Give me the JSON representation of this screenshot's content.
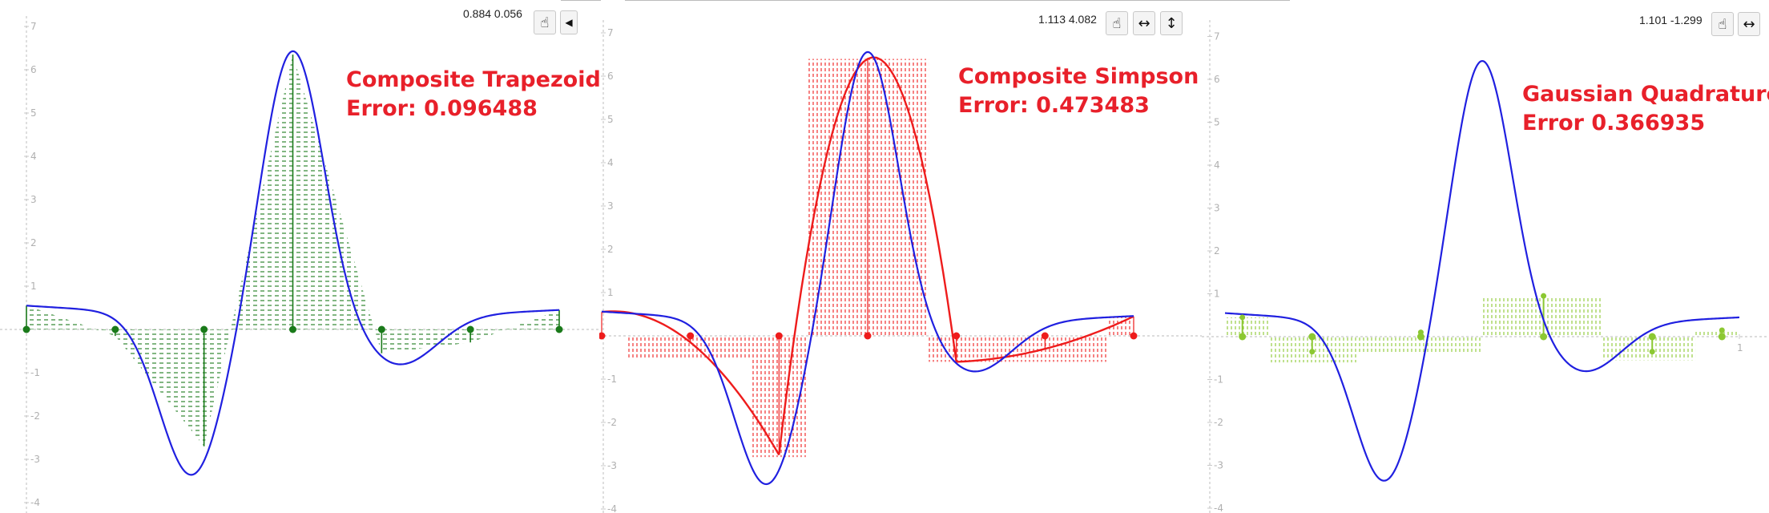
{
  "colors": {
    "curve": "#2020e0",
    "trapezoid": "#1a7a1a",
    "simpson": "#ee1c1c",
    "gauss": "#8cc832",
    "title": "#e8202a",
    "axis": "#c8c8c8",
    "tick_label": "#b0b0b0"
  },
  "chart_data": [
    {
      "type": "line",
      "title": "Composite Trapezoid",
      "error_text": "Error: 0.096488",
      "xlim": [
        0,
        1
      ],
      "ylim": [
        -4,
        7
      ],
      "y_ticks": [
        "-4",
        "-3",
        "-2",
        "-1",
        "1",
        "2",
        "3",
        "4",
        "5",
        "6",
        "7"
      ],
      "curve_peak": {
        "x": 0.5,
        "y": 6.35
      },
      "curve_trough": {
        "x": 0.31,
        "y": -3.2
      },
      "nodes": [
        {
          "x": 0.0,
          "y": 0.55
        },
        {
          "x": 0.1667,
          "y": -0.15
        },
        {
          "x": 0.3333,
          "y": -2.7
        },
        {
          "x": 0.5,
          "y": 6.35
        },
        {
          "x": 0.6667,
          "y": -0.55
        },
        {
          "x": 0.8333,
          "y": -0.3
        },
        {
          "x": 1.0,
          "y": 0.45
        }
      ],
      "readout": "0.884 0.056"
    },
    {
      "type": "line",
      "title": "Composite Simpson",
      "error_text": "Error: 0.473483",
      "xlim": [
        0,
        1
      ],
      "ylim": [
        -4,
        7
      ],
      "y_ticks": [
        "-4",
        "-3",
        "-2",
        "-1",
        "1",
        "2",
        "3",
        "4",
        "5",
        "6",
        "7"
      ],
      "nodes": [
        {
          "x": 0.0,
          "y": 0.55
        },
        {
          "x": 0.1667,
          "y": -0.15
        },
        {
          "x": 0.3333,
          "y": -2.75
        },
        {
          "x": 0.5,
          "y": 6.4
        },
        {
          "x": 0.6667,
          "y": -0.6
        },
        {
          "x": 0.8333,
          "y": -0.3
        },
        {
          "x": 1.0,
          "y": 0.45
        }
      ],
      "simpson_bars": [
        {
          "x0": 0.05,
          "x1": 0.28,
          "h": -0.55
        },
        {
          "x0": 0.28,
          "x1": 0.385,
          "h": -2.8
        },
        {
          "x0": 0.385,
          "x1": 0.615,
          "h": 6.4
        },
        {
          "x0": 0.615,
          "x1": 0.95,
          "h": -0.6
        },
        {
          "x0": 0.95,
          "x1": 1.0,
          "h": 0.45
        }
      ],
      "readout": "1.113 4.082"
    },
    {
      "type": "line",
      "title": "Gaussian Quadrature",
      "error_text": "Error 0.366935",
      "xlim": [
        0,
        1
      ],
      "ylim": [
        -4,
        7
      ],
      "y_ticks": [
        "-4",
        "-3",
        "-2",
        "-1",
        "1",
        "2",
        "3",
        "4",
        "5",
        "6",
        "7"
      ],
      "x_ticks": [
        "1"
      ],
      "nodes": [
        {
          "x": 0.0338,
          "y": 0.45
        },
        {
          "x": 0.1694,
          "y": -0.35
        },
        {
          "x": 0.3807,
          "y": 0.1
        },
        {
          "x": 0.6193,
          "y": 0.95
        },
        {
          "x": 0.8306,
          "y": -0.35
        },
        {
          "x": 0.9662,
          "y": 0.15
        }
      ],
      "gauss_bars": [
        {
          "x0": 0.0,
          "x1": 0.085,
          "h": 0.45
        },
        {
          "x0": 0.085,
          "x1": 0.26,
          "h": -0.6
        },
        {
          "x0": 0.26,
          "x1": 0.5,
          "h": -0.4
        },
        {
          "x0": 0.5,
          "x1": 0.735,
          "h": 0.95
        },
        {
          "x0": 0.735,
          "x1": 0.915,
          "h": -0.55
        },
        {
          "x0": 0.915,
          "x1": 1.0,
          "h": 0.15
        }
      ],
      "readout": "1.101 -1.299"
    }
  ]
}
